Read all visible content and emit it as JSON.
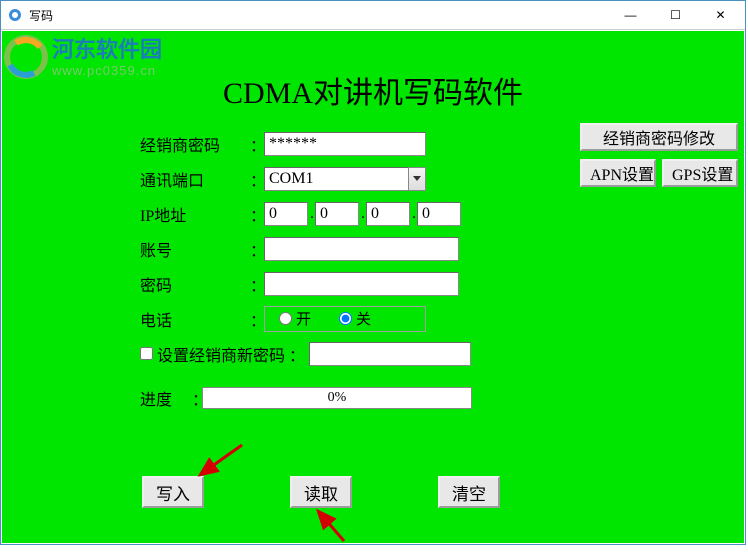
{
  "window": {
    "title": "写码",
    "min_icon": "—",
    "max_icon": "☐",
    "close_icon": "✕"
  },
  "watermark": {
    "name": "河东软件园",
    "url": "www.pc0359.cn"
  },
  "title": "CDMA对讲机写码软件",
  "labels": {
    "dealer_pwd": "经销商密码",
    "port": "通讯端口",
    "ip": "IP地址",
    "account": "账号",
    "password": "密码",
    "phone": "电话",
    "new_dealer_pwd": "设置经销商新密码",
    "progress": "进度",
    "colon": "："
  },
  "values": {
    "dealer_pwd": "******",
    "port": "COM1",
    "ip1": "0",
    "ip2": "0",
    "ip3": "0",
    "ip4": "0",
    "account": "",
    "password": "",
    "progress": "0%"
  },
  "radio": {
    "on": "开",
    "off": "关"
  },
  "buttons": {
    "modify_dealer_pwd": "经销商密码修改",
    "apn": "APN设置",
    "gps": "GPS设置",
    "write": "写入",
    "read": "读取",
    "clear": "清空"
  },
  "indicators": {
    "dot": "."
  }
}
